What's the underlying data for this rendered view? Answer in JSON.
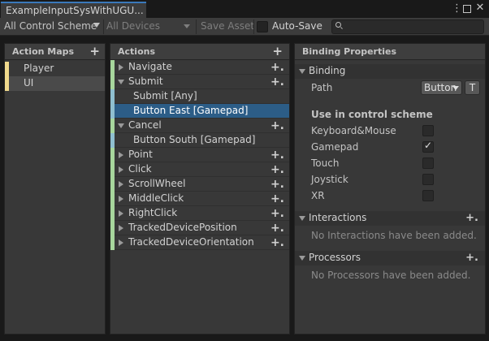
{
  "window": {
    "tab_title": "ExampleInputSysWithUGU...",
    "menu_glyph": "⋮",
    "close_glyph": "✕"
  },
  "toolbar": {
    "control_scheme": "All Control Scheme",
    "devices": "All Devices",
    "save_asset": "Save Asset",
    "auto_save": "Auto-Save",
    "auto_save_checked": false,
    "search_placeholder": ""
  },
  "action_maps": {
    "title": "Action Maps",
    "add_glyph": "+",
    "items": [
      {
        "label": "Player",
        "selected": false
      },
      {
        "label": "UI",
        "selected": true
      }
    ]
  },
  "actions": {
    "title": "Actions",
    "add_glyph": "+",
    "rows": [
      {
        "label": "Navigate",
        "kind": "action",
        "expanded": false,
        "add_glyph": "+."
      },
      {
        "label": "Submit",
        "kind": "action",
        "expanded": true,
        "add_glyph": "+."
      },
      {
        "label": "Submit [Any]",
        "kind": "binding",
        "selected": false
      },
      {
        "label": "Button East [Gamepad]",
        "kind": "binding",
        "selected": true
      },
      {
        "label": "Cancel",
        "kind": "action",
        "expanded": true,
        "add_glyph": "+."
      },
      {
        "label": "Button South [Gamepad]",
        "kind": "binding",
        "selected": false
      },
      {
        "label": "Point",
        "kind": "action",
        "expanded": false,
        "add_glyph": "+."
      },
      {
        "label": "Click",
        "kind": "action",
        "expanded": false,
        "add_glyph": "+."
      },
      {
        "label": "ScrollWheel",
        "kind": "action",
        "expanded": false,
        "add_glyph": "+."
      },
      {
        "label": "MiddleClick",
        "kind": "action",
        "expanded": false,
        "add_glyph": "+."
      },
      {
        "label": "RightClick",
        "kind": "action",
        "expanded": false,
        "add_glyph": "+."
      },
      {
        "label": "TrackedDevicePosition",
        "kind": "action",
        "expanded": false,
        "add_glyph": "+."
      },
      {
        "label": "TrackedDeviceOrientation",
        "kind": "action",
        "expanded": false,
        "add_glyph": "+."
      }
    ]
  },
  "properties": {
    "title": "Binding Properties",
    "binding_section": "Binding",
    "path_label": "Path",
    "path_value": "Button",
    "t_button": "T",
    "use_in_scheme": "Use in control scheme",
    "schemes": [
      {
        "label": "Keyboard&Mouse",
        "checked": false,
        "mark": ""
      },
      {
        "label": "Gamepad",
        "checked": true,
        "mark": "✓"
      },
      {
        "label": "Touch",
        "checked": false,
        "mark": ""
      },
      {
        "label": "Joystick",
        "checked": false,
        "mark": ""
      },
      {
        "label": "XR",
        "checked": false,
        "mark": ""
      }
    ],
    "interactions_section": "Interactions",
    "interactions_empty": "No Interactions have been added.",
    "processors_section": "Processors",
    "processors_empty": "No Processors have been added.",
    "add_glyph": "+."
  }
}
